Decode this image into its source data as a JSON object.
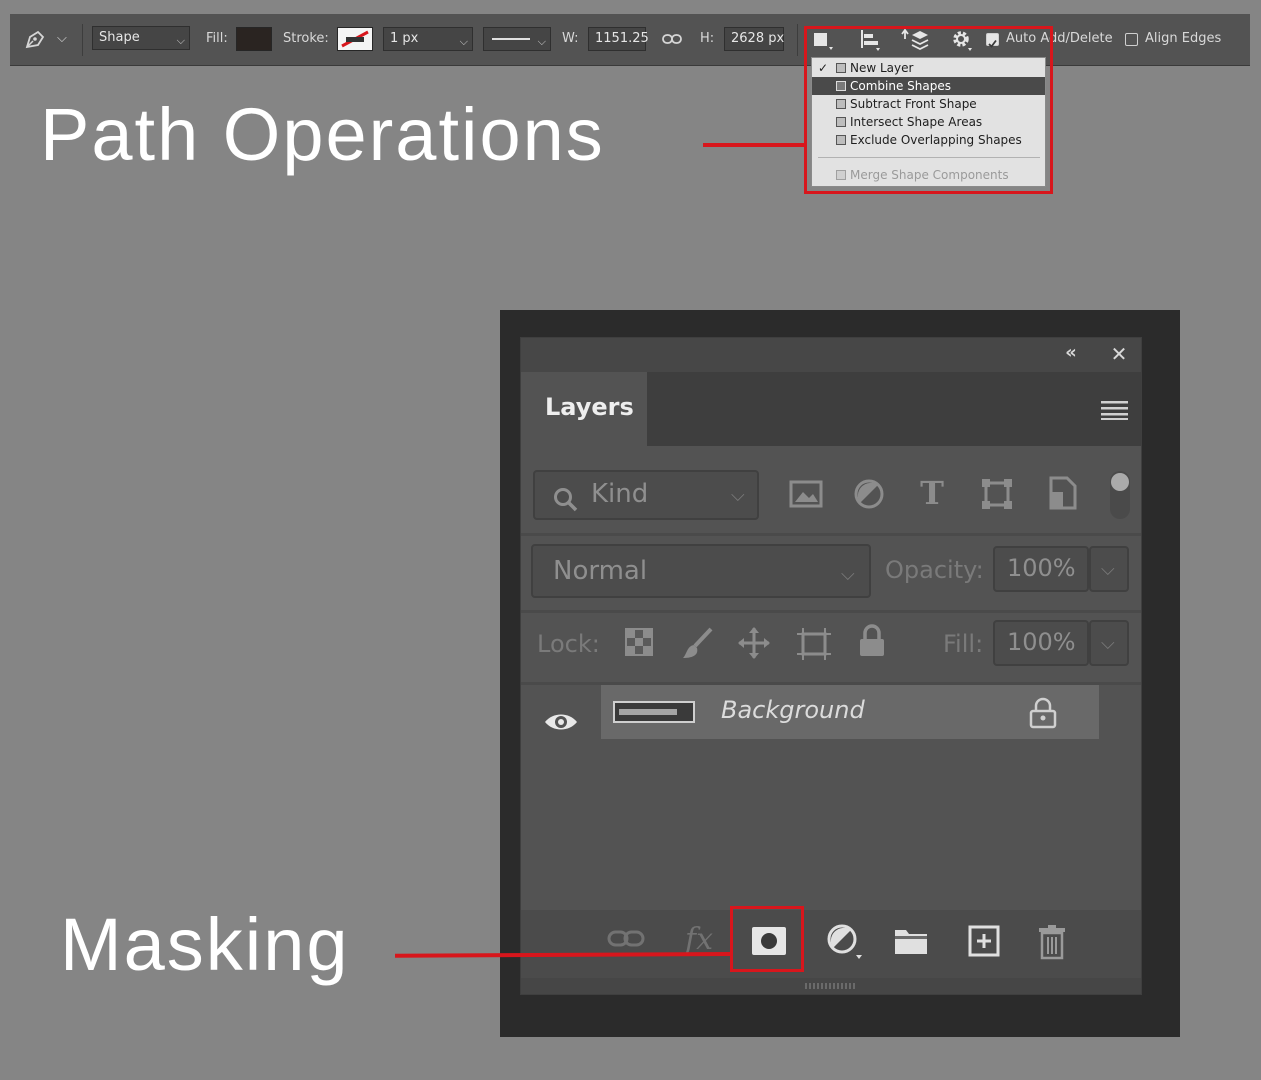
{
  "options_bar": {
    "tool_mode": "Shape",
    "fill_label": "Fill:",
    "fill_color": "#2a2421",
    "stroke_label": "Stroke:",
    "stroke_width": "1 px",
    "w_label": "W:",
    "w_value": "1151.25",
    "h_label": "H:",
    "h_value": "2628 px",
    "auto_add_delete": {
      "label": "Auto Add/Delete",
      "checked": true
    },
    "align_edges": {
      "label": "Align Edges",
      "checked": false
    }
  },
  "path_ops_menu": {
    "items": [
      {
        "label": "New Layer",
        "checked": true,
        "highlighted": false,
        "disabled": false
      },
      {
        "label": "Combine Shapes",
        "checked": false,
        "highlighted": true,
        "disabled": false
      },
      {
        "label": "Subtract Front Shape",
        "checked": false,
        "highlighted": false,
        "disabled": false
      },
      {
        "label": "Intersect Shape Areas",
        "checked": false,
        "highlighted": false,
        "disabled": false
      },
      {
        "label": "Exclude Overlapping Shapes",
        "checked": false,
        "highlighted": false,
        "disabled": false
      },
      {
        "label": "Merge Shape Components",
        "checked": false,
        "highlighted": false,
        "disabled": true
      }
    ]
  },
  "callouts": {
    "path_operations": "Path Operations",
    "masking": "Masking",
    "accent_color": "#d8161c"
  },
  "layers_panel": {
    "tab_label": "Layers",
    "filter_placeholder": "Kind",
    "blend_mode": "Normal",
    "opacity_label": "Opacity:",
    "opacity_value": "100%",
    "lock_label": "Lock:",
    "fill_label": "Fill:",
    "fill_value": "100%",
    "layers": [
      {
        "name": "Background",
        "visible": true,
        "locked": true
      }
    ]
  }
}
